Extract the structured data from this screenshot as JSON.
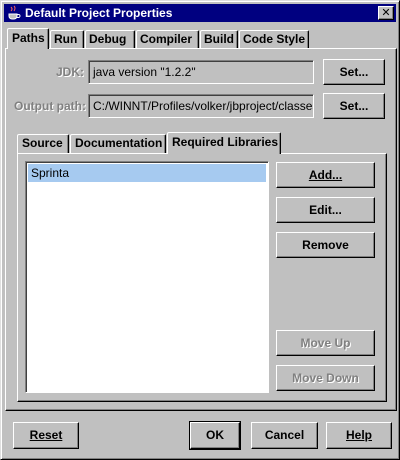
{
  "window": {
    "title": "Default Project Properties",
    "close_glyph": "✕",
    "icon": "java-cup-icon"
  },
  "tabs": [
    {
      "label": "Paths",
      "active": true
    },
    {
      "label": "Run",
      "active": false
    },
    {
      "label": "Debug",
      "active": false
    },
    {
      "label": "Compiler",
      "active": false
    },
    {
      "label": "Build",
      "active": false
    },
    {
      "label": "Code Style",
      "active": false
    }
  ],
  "paths": {
    "jdk_label": "JDK:",
    "jdk_value": "java version \"1.2.2\"",
    "jdk_set": "Set...",
    "output_label": "Output path:",
    "output_value": "C:/WINNT/Profiles/volker/jbproject/classes",
    "output_set": "Set..."
  },
  "subtabs": [
    {
      "label": "Source",
      "active": false
    },
    {
      "label": "Documentation",
      "active": false
    },
    {
      "label": "Required Libraries",
      "active": true
    }
  ],
  "libraries": {
    "items": [
      {
        "label": "Sprinta",
        "selected": true
      }
    ],
    "buttons": {
      "add": "Add...",
      "edit": "Edit...",
      "remove": "Remove",
      "move_up": "Move Up",
      "move_down": "Move Down"
    }
  },
  "footer": {
    "reset": "Reset",
    "ok": "OK",
    "cancel": "Cancel",
    "help": "Help"
  }
}
